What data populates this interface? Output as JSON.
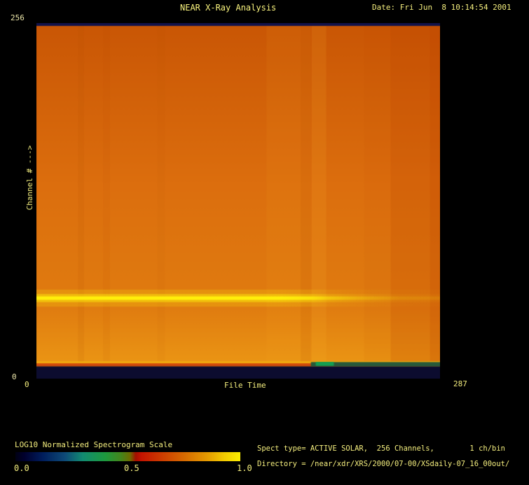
{
  "header": {
    "title": "NEAR X-Ray Analysis",
    "date": "Date: Fri Jun  8 10:14:54 2001"
  },
  "axes": {
    "y_max": "256",
    "y_min": "0",
    "y_label": "Channel # --->",
    "x_min": "0",
    "x_max": "287",
    "x_label": "File Time"
  },
  "colorbar": {
    "label": "LOG10 Normalized Spectrogram Scale",
    "tick_min": "0.0",
    "tick_mid": "0.5",
    "tick_max": "1.0"
  },
  "info": {
    "spect_line": "Spect type= ACTIVE SOLAR,  256 Channels,        1 ch/bin",
    "directory_line": "Directory = /near/xdr/XRS/2000/07-00/XSdaily-07_16_00out/"
  },
  "colors": {
    "background": "#000000",
    "label_text": "#f4ee7e",
    "heatmap_body": "#dd6e0e",
    "emission_line": "#fff000",
    "dead_band": "#0c0c2f"
  },
  "chart_data": {
    "type": "heatmap",
    "title": "NEAR X-Ray Analysis",
    "xlabel": "File Time",
    "ylabel": "Channel # --->",
    "x_range": [
      0,
      287
    ],
    "y_range": [
      0,
      256
    ],
    "colorbar_label": "LOG10 Normalized Spectrogram Scale",
    "colorbar_range": [
      0.0,
      1.0
    ],
    "colorbar_ticks": [
      0.0,
      0.5,
      1.0
    ],
    "features": {
      "description": "Mostly uniform mid-intensity orange background over all 256 channels and full time span; intensity increases slightly toward low channels; bright yellow emission line near channel 58 fading after ~68% of time span; darker red-orange vertical band in final ~12% of time span; navy near-zero dead band at channels 0-9 with a green-teal boundary line on the right half",
      "emission_line_channel": 58,
      "dead_band_channels": [
        0,
        9
      ],
      "dead_band_green_segment_time_fraction": [
        0.68,
        1.0
      ]
    },
    "colorbar_stops": [
      [
        0.0,
        "#000014"
      ],
      [
        0.04,
        "#00002e"
      ],
      [
        0.12,
        "#001d5c"
      ],
      [
        0.22,
        "#0e4a78"
      ],
      [
        0.3,
        "#128c71"
      ],
      [
        0.4,
        "#1e9a3e"
      ],
      [
        0.47,
        "#45861c"
      ],
      [
        0.51,
        "#6e6c00"
      ],
      [
        0.535,
        "#a40e00"
      ],
      [
        0.56,
        "#c41400"
      ],
      [
        0.65,
        "#cd3c00"
      ],
      [
        0.75,
        "#d66a00"
      ],
      [
        0.85,
        "#e59a00"
      ],
      [
        0.93,
        "#f4cc00"
      ],
      [
        1.0,
        "#fcee00"
      ]
    ],
    "render": {
      "base_stops": [
        [
          0.0,
          "#c95605"
        ],
        [
          0.45,
          "#dc6e0e"
        ],
        [
          0.8,
          "#e07c10"
        ],
        [
          0.95,
          "#ea9414"
        ],
        [
          1.0,
          "#eda015"
        ]
      ],
      "vbands": [
        {
          "x0": 0.103,
          "x1": 0.118,
          "c": "#b34a00",
          "a": 0.1
        },
        {
          "x0": 0.165,
          "x1": 0.182,
          "c": "#b34a00",
          "a": 0.07
        },
        {
          "x0": 0.3,
          "x1": 0.318,
          "c": "#b34a00",
          "a": 0.05
        },
        {
          "x0": 0.57,
          "x1": 0.68,
          "c": "#ffb728",
          "a": 0.08
        },
        {
          "x0": 0.655,
          "x1": 0.68,
          "c": "#b84800",
          "a": 0.12
        },
        {
          "x0": 0.682,
          "x1": 0.718,
          "c": "#ffc030",
          "a": 0.12
        },
        {
          "x0": 0.812,
          "x1": 0.878,
          "c": "#c04800",
          "a": 0.06
        },
        {
          "x0": 0.878,
          "x1": 1.0,
          "c": "#bc3f00",
          "a": 0.22
        },
        {
          "x0": 0.975,
          "x1": 1.0,
          "c": "#b83c00",
          "a": 0.16
        }
      ],
      "line_rgb": "255,240,10",
      "line_y": 0.7736,
      "line_layers": [
        {
          "half": 0.024,
          "alpha": 0.2
        },
        {
          "half": 0.0115,
          "alpha": 0.45
        },
        {
          "half": 0.0048,
          "alpha": 1.0
        }
      ],
      "line_fade": [
        [
          0.0,
          1.0
        ],
        [
          0.6,
          1.0
        ],
        [
          0.68,
          0.8
        ],
        [
          0.72,
          0.5
        ],
        [
          0.8,
          0.28
        ],
        [
          0.9,
          0.12
        ],
        [
          1.0,
          0.1
        ]
      ],
      "hbands": [
        {
          "y0": 0.0,
          "y1": 0.008,
          "c": "#12124a"
        },
        {
          "y0": 0.951,
          "y1": 0.957,
          "c": "#f0a90f"
        },
        {
          "y0": 0.957,
          "y1": 0.9655,
          "c": "#d14a0b"
        },
        {
          "y0": 0.9655,
          "y1": 1.0,
          "c": "#0c0c2f"
        },
        {
          "x0": 0.68,
          "x1": 1.0,
          "y0": 0.9535,
          "y1": 0.9655,
          "c": "#27593a"
        },
        {
          "x0": 0.692,
          "x1": 0.737,
          "y0": 0.953,
          "y1": 0.964,
          "c": "#139e52"
        }
      ]
    }
  }
}
